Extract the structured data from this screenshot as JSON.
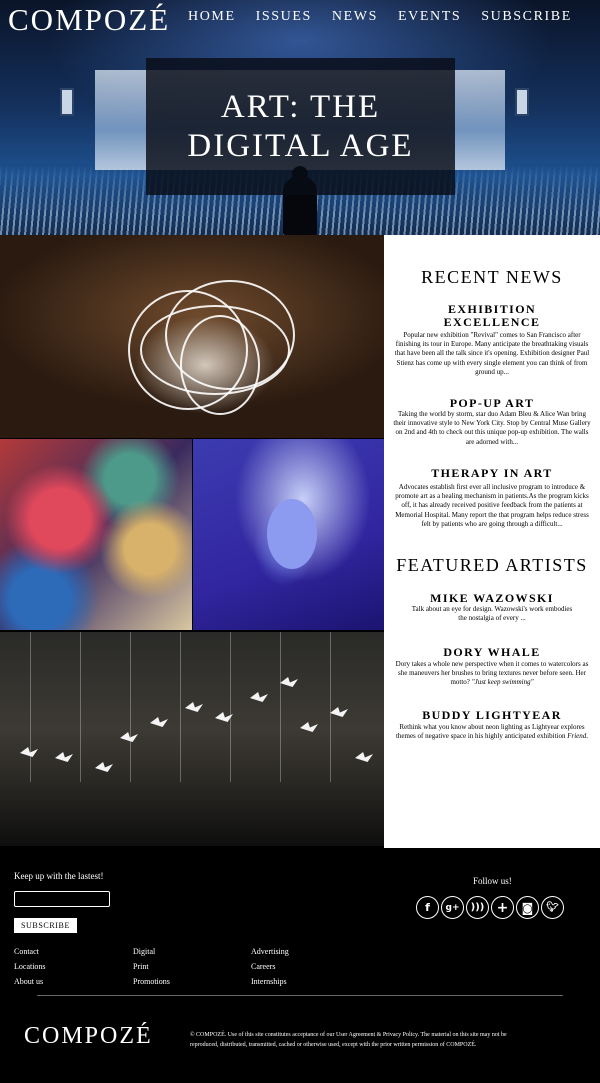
{
  "brand": {
    "logo": "COMPOZÉ"
  },
  "nav": {
    "items": [
      "HOME",
      "ISSUES",
      "NEWS",
      "EVENTS",
      "SUBSCRIBE"
    ]
  },
  "hero": {
    "title": "ART: THE DIGITAL AGE"
  },
  "recent_news": {
    "heading": "RECENT NEWS",
    "articles": [
      {
        "title": "EXHIBITION EXCELLENCE",
        "body": "Popular new exhibition \"Revival\" comes to San Francisco after finishing its tour in Europe. Many anticipate the breathtaking visuals that have been all the talk since it's opening. Exhibition designer Paul Stienz has come up with every single element you can think of from ground up..."
      },
      {
        "title": "POP-UP ART",
        "body": "Taking the world by storm, star duo Adam Bleu & Alice Wan bring their innovative style to New York City. Stop by Central Muse Gallery on 2nd and 4th to check out this unique pop-up exhibition. The walls are adorned with..."
      },
      {
        "title": "THERAPY IN ART",
        "body": "Advocates establish first ever all inclusive program to introduce & promote art as a healing mechanism in patients.As the program kicks off, it has already received positive feedback from the patients at Memorial Hospital. Many report the that program helps reduce stress felt by patients who are going through a difficult..."
      }
    ]
  },
  "featured_artists": {
    "heading": "FEATURED ARTISTS",
    "artists": [
      {
        "name": "MIKE WAZOWSKI",
        "body": "Talk about an eye for design. Wazowski's work embodies the nostalgia of every ..."
      },
      {
        "name": "DORY WHALE",
        "body_before": "Dory takes a whole new perspective when it comes to watercolors as she maneuvers her brushes to bring textures never before seen. Her motto? ",
        "body_italic": "\"Just keep swimming\""
      },
      {
        "name": "BUDDY LIGHTYEAR",
        "body_before": "Rethink what you know about neon lighting as Lightyear explores themes of negative space in his highly anticipated exhibition ",
        "body_italic": "Friend",
        "body_after": "."
      }
    ]
  },
  "footer": {
    "keep_up": "Keep up with the lastest!",
    "email_value": "",
    "subscribe_label": "SUBSCRIBE",
    "follow": "Follow us!",
    "social_icons": [
      "facebook-icon",
      "google-plus-icon",
      "rss-icon",
      "add-icon",
      "instagram-icon",
      "twitter-icon"
    ],
    "links_col1": [
      "Contact",
      "Locations",
      "About us"
    ],
    "links_col2": [
      "Digital",
      "Print",
      "Promotions"
    ],
    "links_col3": [
      "Advertising",
      "Careers",
      "Internships"
    ],
    "logo": "COMPOZÉ",
    "legal": "© COMPOZÉ. Use of this site constitutes acceptance of our User Agreement & Privacy Policy. The material on this site may not be reproduced, distributed, transmitted, cached or otherwise used, except with the prior written permission of COMPOZÉ."
  }
}
